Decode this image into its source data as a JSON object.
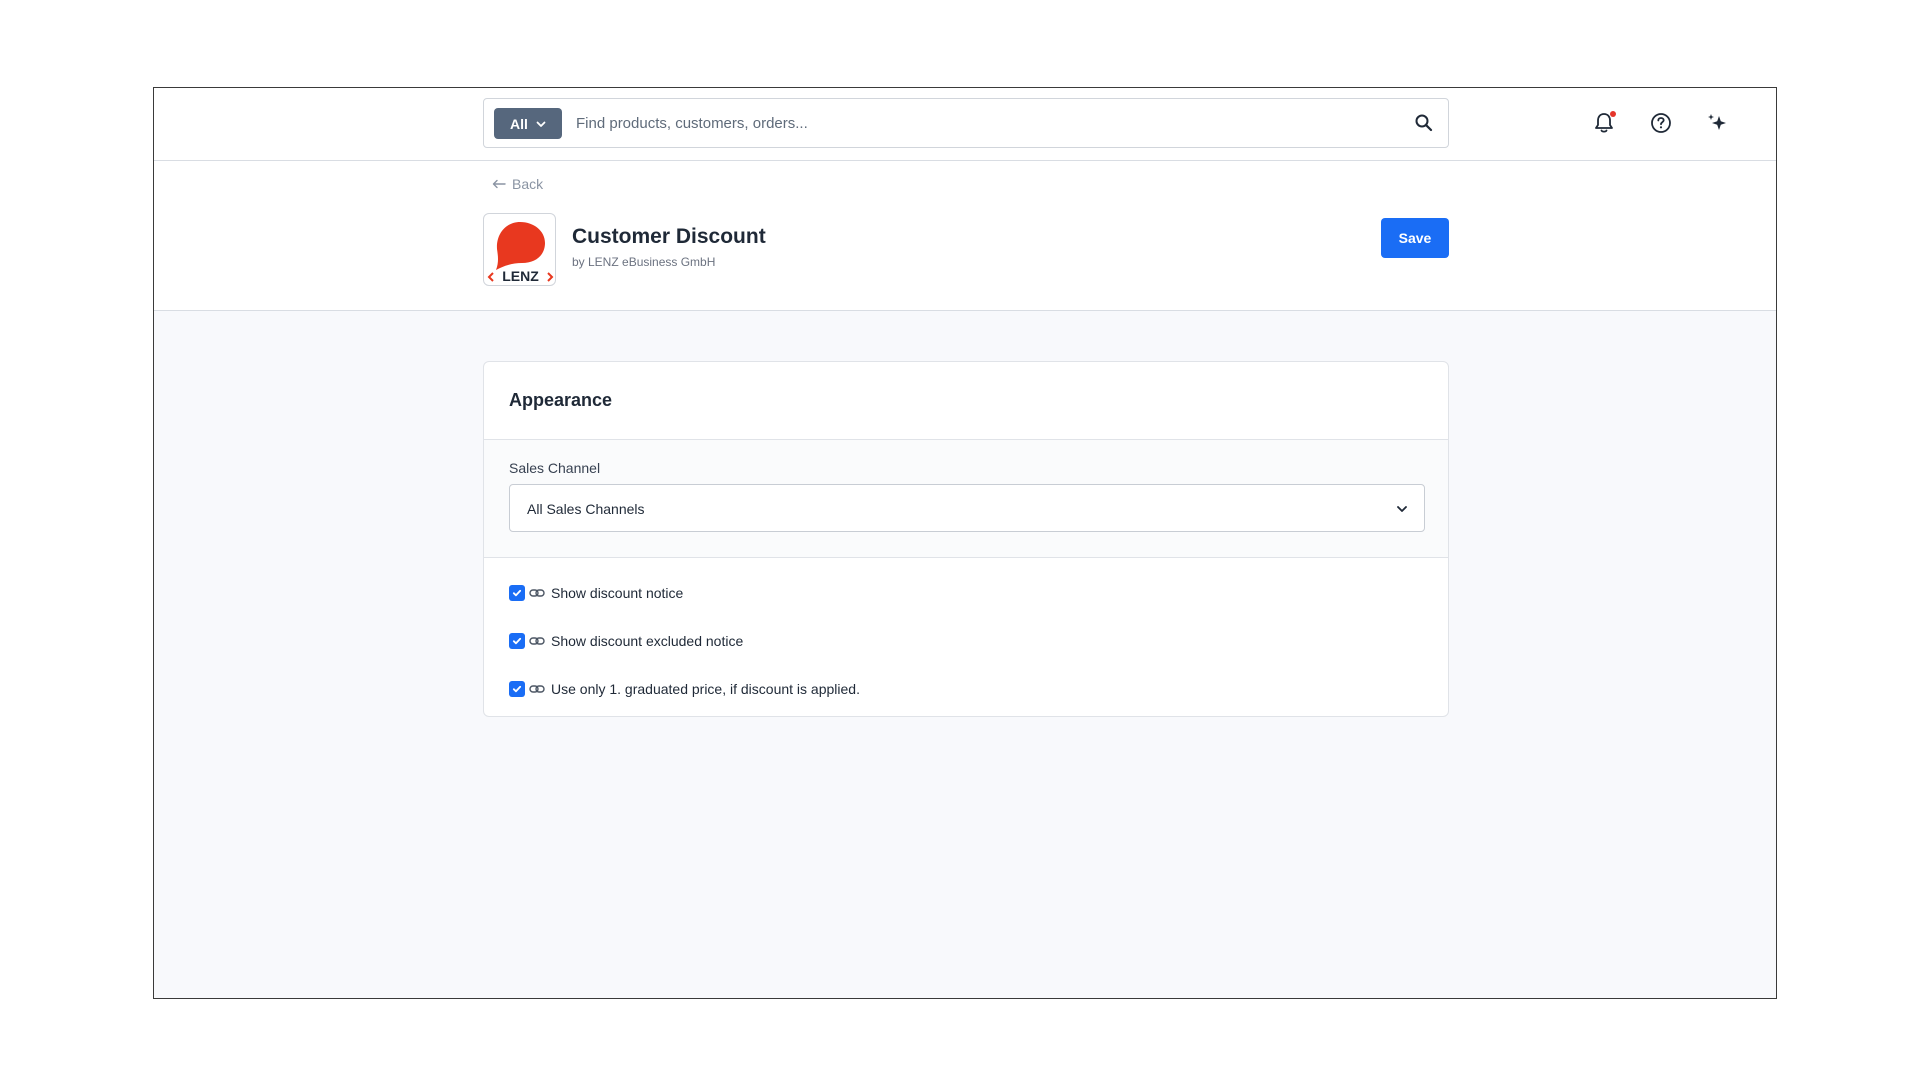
{
  "topbar": {
    "search": {
      "scope_label": "All",
      "placeholder": "Find products, customers, orders...",
      "value": ""
    },
    "icons": [
      "bell-icon",
      "help-icon",
      "sparkle-icon"
    ]
  },
  "header": {
    "back_label": "Back",
    "app_title": "Customer Discount",
    "app_vendor": "by LENZ eBusiness GmbH",
    "logo_text": "LENZ",
    "save_label": "Save"
  },
  "card": {
    "title": "Appearance",
    "sales_channel": {
      "label": "Sales Channel",
      "selected": "All Sales Channels"
    },
    "options": [
      {
        "label": "Show discount notice",
        "checked": true
      },
      {
        "label": "Show discount excluded notice",
        "checked": true
      },
      {
        "label": "Use only 1. graduated price, if discount is applied.",
        "checked": true
      }
    ]
  },
  "colors": {
    "primary": "#1a6df5",
    "scope_bg": "#56677d",
    "logo_red": "#e8381f",
    "notification_dot": "#e5352b",
    "content_bg": "#f8f9fc"
  }
}
